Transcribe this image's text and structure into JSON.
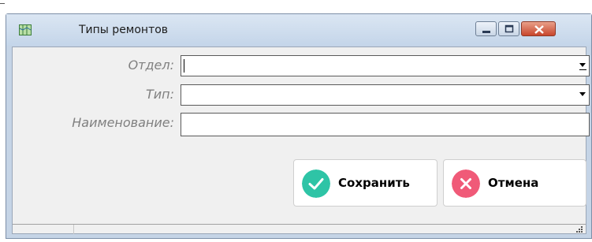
{
  "window": {
    "title": "Типы ремонтов"
  },
  "icons": {
    "app": "document-map-icon",
    "minimize": "minimize-icon",
    "maximize": "maximize-icon",
    "close": "close-icon",
    "save": "check-icon",
    "cancel": "cross-icon",
    "grip": "resize-grip-icon"
  },
  "colors": {
    "save_accent": "#2ec4a6",
    "cancel_accent": "#f05a78",
    "close_button": "#c8462c"
  },
  "form": {
    "department": {
      "label": "Отдел:",
      "value": ""
    },
    "type": {
      "label": "Тип:",
      "value": ""
    },
    "name": {
      "label": "Наименование:",
      "value": ""
    }
  },
  "buttons": {
    "save_label": "Сохранить",
    "cancel_label": "Отмена"
  }
}
